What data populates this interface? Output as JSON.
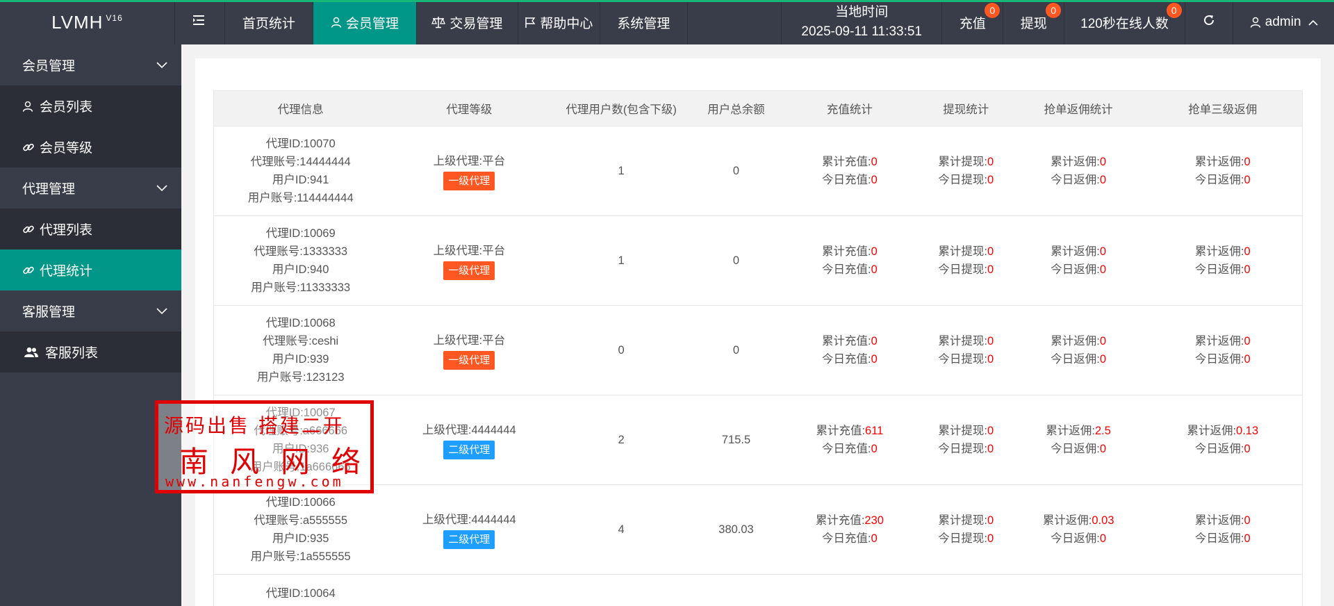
{
  "header": {
    "logo": "LVMH",
    "logo_version": "V16",
    "nav": [
      {
        "label": "首页统计"
      },
      {
        "label": "会员管理"
      },
      {
        "label": "交易管理"
      },
      {
        "label": "帮助中心"
      },
      {
        "label": "系统管理"
      }
    ],
    "time_label": "当地时间",
    "time_value": "2025-09-11 11:33:51",
    "recharge_label": "充值",
    "recharge_badge": "0",
    "withdraw_label": "提现",
    "withdraw_badge": "0",
    "online_label": "120秒在线人数",
    "online_badge": "0",
    "user": "admin"
  },
  "sidebar": {
    "groups": [
      {
        "label": "会员管理",
        "items": [
          {
            "label": "会员列表"
          },
          {
            "label": "会员等级"
          }
        ]
      },
      {
        "label": "代理管理",
        "items": [
          {
            "label": "代理列表"
          },
          {
            "label": "代理统计"
          }
        ]
      },
      {
        "label": "客服管理",
        "items": [
          {
            "label": "客服列表"
          }
        ]
      }
    ]
  },
  "table": {
    "columns": [
      "代理信息",
      "代理等级",
      "代理用户数(包含下级)",
      "用户总余额",
      "充值统计",
      "提现统计",
      "抢单返佣统计",
      "抢单三级返佣"
    ],
    "labels": {
      "agent_id": "代理ID:",
      "agent_account": "代理账号:",
      "user_id": "用户ID:",
      "user_account": "用户账号:",
      "parent": "上级代理:",
      "total_recharge": "累计充值:",
      "today_recharge": "今日充值:",
      "total_withdraw": "累计提现:",
      "today_withdraw": "今日提现:",
      "total_commission": "累计返佣:",
      "today_commission": "今日返佣:"
    },
    "rows": [
      {
        "agent_id": "10070",
        "agent_account": "14444444",
        "user_id": "941",
        "user_account": "114444444",
        "parent": "平台",
        "level": "一级代理",
        "level_color": "#ff5722",
        "users": "1",
        "balance": "0",
        "total_recharge": "0",
        "today_recharge": "0",
        "total_withdraw": "0",
        "today_withdraw": "0",
        "total_commission": "0",
        "today_commission": "0",
        "total_commission3": "0",
        "today_commission3": "0"
      },
      {
        "agent_id": "10069",
        "agent_account": "1333333",
        "user_id": "940",
        "user_account": "11333333",
        "parent": "平台",
        "level": "一级代理",
        "level_color": "#ff5722",
        "users": "1",
        "balance": "0",
        "total_recharge": "0",
        "today_recharge": "0",
        "total_withdraw": "0",
        "today_withdraw": "0",
        "total_commission": "0",
        "today_commission": "0",
        "total_commission3": "0",
        "today_commission3": "0"
      },
      {
        "agent_id": "10068",
        "agent_account": "ceshi",
        "user_id": "939",
        "user_account": "123123",
        "parent": "平台",
        "level": "一级代理",
        "level_color": "#ff5722",
        "users": "0",
        "balance": "0",
        "total_recharge": "0",
        "today_recharge": "0",
        "total_withdraw": "0",
        "today_withdraw": "0",
        "total_commission": "0",
        "today_commission": "0",
        "total_commission3": "0",
        "today_commission3": "0"
      },
      {
        "agent_id": "10067",
        "agent_account": "a666666",
        "user_id": "936",
        "user_account": "1a666666",
        "parent": "4444444",
        "level": "二级代理",
        "level_color": "#1e9fff",
        "users": "2",
        "balance": "715.5",
        "total_recharge": "611",
        "today_recharge": "0",
        "total_withdraw": "0",
        "today_withdraw": "0",
        "total_commission": "2.5",
        "today_commission": "0",
        "total_commission3": "0.13",
        "today_commission3": "0"
      },
      {
        "agent_id": "10066",
        "agent_account": "a555555",
        "user_id": "935",
        "user_account": "1a555555",
        "parent": "4444444",
        "level": "二级代理",
        "level_color": "#1e9fff",
        "users": "4",
        "balance": "380.03",
        "total_recharge": "230",
        "today_recharge": "0",
        "total_withdraw": "0",
        "today_withdraw": "0",
        "total_commission": "0.03",
        "today_commission": "0",
        "total_commission3": "0",
        "today_commission3": "0"
      }
    ],
    "partial_row": {
      "agent_id": "10064"
    }
  },
  "watermark": {
    "line1": "源码出售 搭建二开",
    "line2": "南风网络",
    "line3": "www.nanfengw.com"
  }
}
